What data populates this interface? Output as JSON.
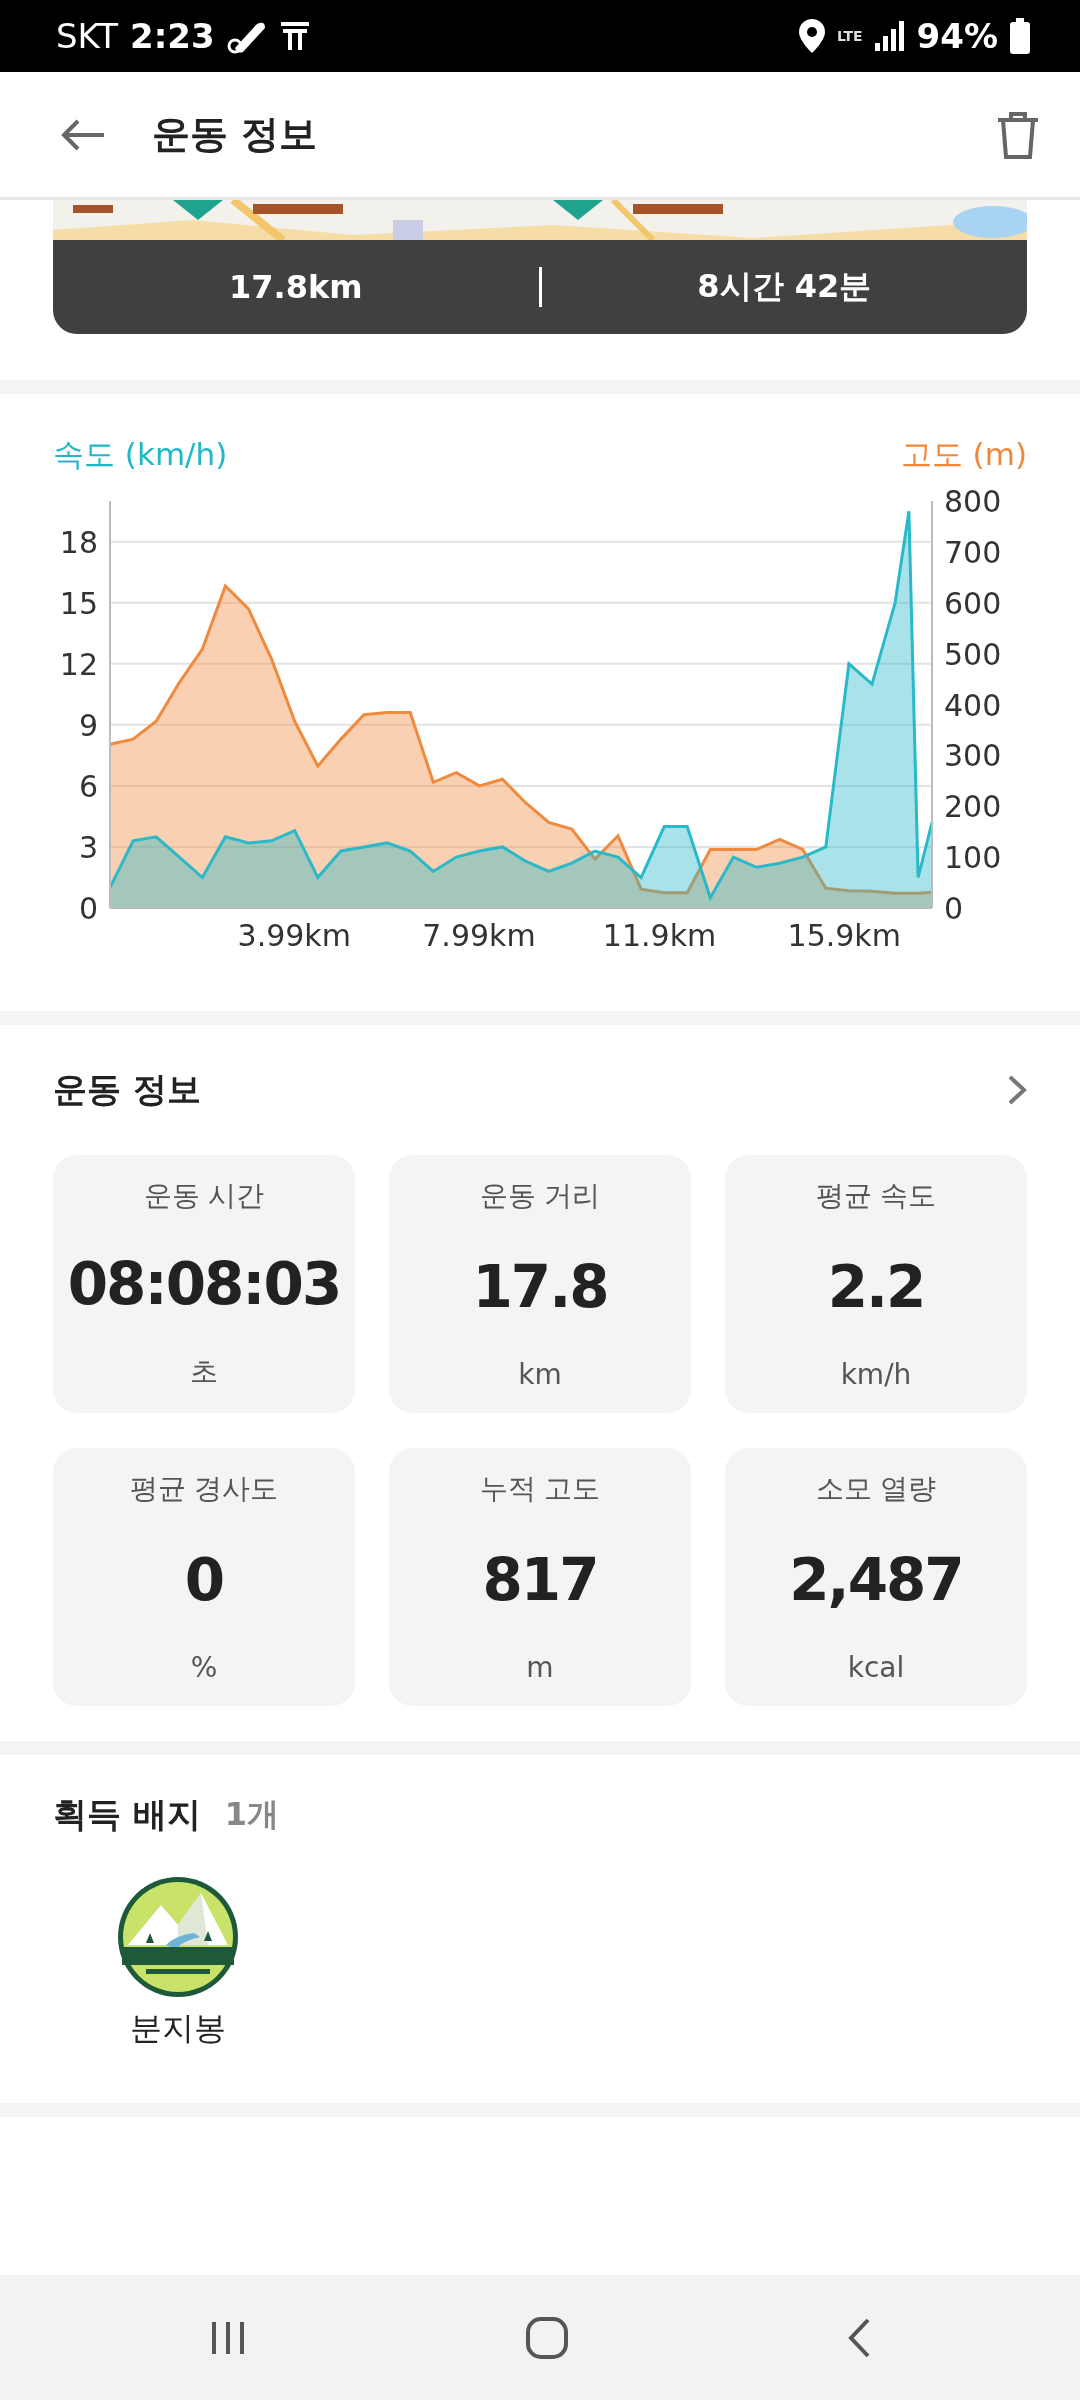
{
  "status_bar": {
    "carrier": "SKT",
    "time": "2:23",
    "network": "LTE",
    "battery": "94%"
  },
  "app_bar": {
    "title": "운동 정보"
  },
  "summary": {
    "distance": "17.8km",
    "duration": "8시간 42분"
  },
  "chart": {
    "chart_data": {
      "type": "area",
      "grid": true,
      "ylim": [
        0,
        20
      ],
      "yticks": [
        0,
        3,
        6,
        9,
        12,
        15,
        18
      ],
      "y2lim": [
        0,
        800
      ],
      "y2ticks": [
        0,
        100,
        200,
        300,
        400,
        500,
        600,
        700,
        800
      ],
      "xlim": [
        0,
        17.8
      ],
      "xticks": [
        {
          "value": 3.99,
          "label": "3.99km"
        },
        {
          "value": 7.99,
          "label": "7.99km"
        },
        {
          "value": 11.9,
          "label": "11.9km"
        },
        {
          "value": 15.9,
          "label": "15.9km"
        }
      ],
      "x": [
        0,
        0.5,
        1,
        1.5,
        2,
        2.5,
        3,
        3.5,
        4,
        4.5,
        5,
        5.5,
        6,
        6.5,
        7,
        7.5,
        8,
        8.5,
        9,
        9.5,
        10,
        10.5,
        11,
        11.5,
        12,
        12.5,
        13,
        13.5,
        14,
        14.5,
        15,
        15.5,
        16,
        16.5,
        17,
        17.3,
        17.5,
        17.8
      ],
      "series": [
        {
          "name": "속도 (km/h)",
          "color": "#29b9c9",
          "values": [
            1,
            3.3,
            3.5,
            2.5,
            1.5,
            3.5,
            3.2,
            3.3,
            3.8,
            1.5,
            2.8,
            3,
            3.2,
            2.8,
            1.8,
            2.5,
            2.8,
            3,
            2.3,
            1.8,
            2.2,
            2.8,
            2.5,
            1.5,
            4,
            4,
            0.5,
            2.5,
            2,
            2.2,
            2.5,
            3,
            12,
            11,
            15,
            19.5,
            1.5,
            4.2
          ]
        },
        {
          "name": "고도 (m)",
          "axis": "y2",
          "color": "#f08a3e",
          "values": [
            322,
            332,
            367,
            443,
            509,
            633,
            588,
            489,
            367,
            279,
            332,
            380,
            384,
            384,
            247,
            266,
            240,
            253,
            207,
            168,
            155,
            96,
            142,
            37,
            30,
            30,
            115,
            115,
            115,
            135,
            115,
            39,
            34,
            33,
            29,
            29,
            29,
            31
          ]
        }
      ]
    }
  },
  "info": {
    "title": "운동 정보",
    "stats": [
      {
        "label": "운동 시간",
        "value": "08:08:03",
        "unit": "초"
      },
      {
        "label": "운동 거리",
        "value": "17.8",
        "unit": "km"
      },
      {
        "label": "평균 속도",
        "value": "2.2",
        "unit": "km/h"
      },
      {
        "label": "평균 경사도",
        "value": "0",
        "unit": "%"
      },
      {
        "label": "누적 고도",
        "value": "817",
        "unit": "m"
      },
      {
        "label": "소모 열량",
        "value": "2,487",
        "unit": "kcal"
      }
    ]
  },
  "badges": {
    "title": "획득 배지",
    "count": "1개",
    "items": [
      {
        "name": "분지봉",
        "kind": "picture"
      }
    ]
  }
}
